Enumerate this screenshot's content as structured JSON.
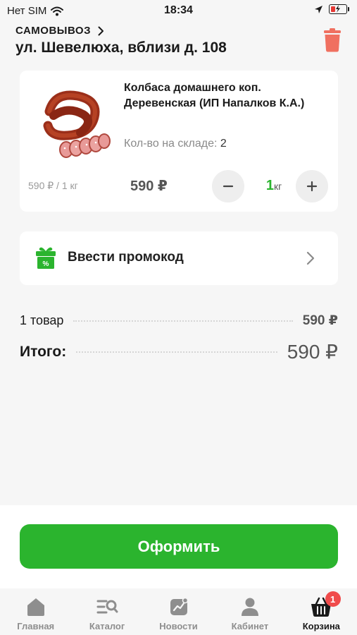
{
  "status_bar": {
    "carrier": "Нет SIM",
    "time": "18:34",
    "battery_level": 0.3
  },
  "header": {
    "pickup_label": "САМОВЫВОЗ",
    "address": "ул. Шевелюха, вблизи д. 108"
  },
  "product": {
    "name": "Колбаса домашнего коп. Деревенская (ИП Напалков К.А.)",
    "stock_label": "Кол-во на складе:",
    "stock_value": "2",
    "unit_price": "590 ₽ / 1 кг",
    "price": "590 ₽",
    "quantity": "1",
    "quantity_unit": "кг",
    "image": "smoked-sausage-image"
  },
  "promo": {
    "label": "Ввести промокод",
    "icon": "gift-icon"
  },
  "summary": {
    "items_label": "1 товар",
    "items_value": "590 ₽",
    "total_label": "Итого:",
    "total_value": "590 ₽"
  },
  "checkout": {
    "label": "Оформить"
  },
  "tab_bar": {
    "items": [
      {
        "label": "Главная",
        "icon": "home-icon"
      },
      {
        "label": "Каталог",
        "icon": "catalog-icon"
      },
      {
        "label": "Новости",
        "icon": "news-icon"
      },
      {
        "label": "Кабинет",
        "icon": "profile-icon"
      },
      {
        "label": "Корзина",
        "icon": "basket-icon",
        "active": true,
        "badge": "1"
      }
    ]
  },
  "colors": {
    "accent": "#2bb42e",
    "delete": "#f07060",
    "badge": "#f04b4b"
  }
}
